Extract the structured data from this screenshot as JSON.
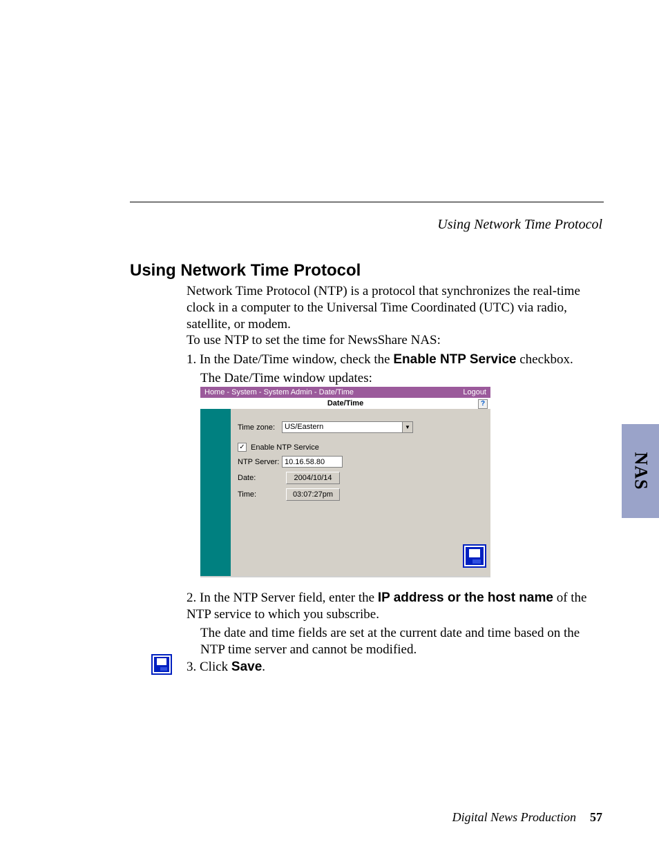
{
  "running_head": "Using Network Time Protocol",
  "section_heading": "Using Network Time Protocol",
  "intro_para": "Network Time Protocol (NTP) is a protocol that synchronizes the real-time clock in a computer to the Universal Time Coordinated (UTC) via radio, satellite, or modem.",
  "intro_para2": "To use NTP to set the time for NewsShare NAS:",
  "step1_prefix": "1. In the Date/Time window, check the ",
  "step1_bold": "Enable NTP Service",
  "step1_suffix": " checkbox.",
  "step1_sub": "The Date/Time window updates:",
  "step2_prefix": "2. In the NTP Server field, enter the ",
  "step2_bold": "IP address or the host name",
  "step2_suffix": " of the NTP service to which you subscribe.",
  "step2_sub": "The date and time fields are set at the current date and time based on the NTP time server and cannot be modified.",
  "step3_prefix": "3. Click ",
  "step3_bold": "Save",
  "step3_suffix": ".",
  "side_tab": "NAS",
  "footer_title": "Digital News Production",
  "footer_page": "57",
  "ui": {
    "breadcrumb": "Home - System - System Admin - Date/Time",
    "logout": "Logout",
    "panel_title": "Date/Time",
    "help_glyph": "?",
    "timezone_label": "Time zone:",
    "timezone_value": "US/Eastern",
    "enable_ntp_label": "Enable NTP Service",
    "enable_ntp_checked": "✓",
    "ntp_server_label": "NTP Server:",
    "ntp_server_value": "10.16.58.80",
    "date_label": "Date:",
    "date_value": "2004/10/14",
    "time_label": "Time:",
    "time_value": "03:07:27pm"
  }
}
